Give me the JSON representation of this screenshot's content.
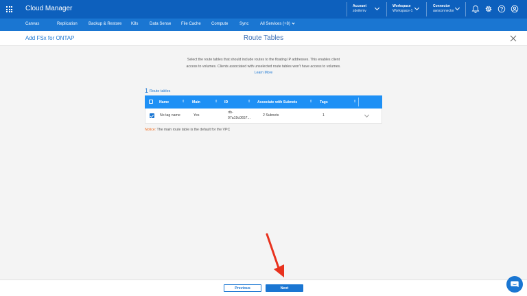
{
  "app": {
    "title": "Cloud Manager"
  },
  "topbar": {
    "account": {
      "label": "Account",
      "value": "zdeilemv"
    },
    "workspace": {
      "label": "Workspace",
      "value": "Workspace-1"
    },
    "connector": {
      "label": "Connector",
      "value": "awsconnector"
    },
    "icons": [
      "bell-icon",
      "gear-icon",
      "help-icon",
      "user-icon"
    ]
  },
  "nav": {
    "items": [
      "Canvas",
      "Replication",
      "Backup & Restore",
      "K8s",
      "Data Sense",
      "File Cache",
      "Compute",
      "Sync"
    ],
    "more": "All Services (+8)"
  },
  "header": {
    "back_title": "Add FSx for ONTAP",
    "page_title": "Route Tables"
  },
  "description": {
    "text": "Select the route tables that should include routes to the floating IP addresses. This enables client access to volumes. Clients associated with unselected route tables won't have access to volumes.",
    "link": "Learn More"
  },
  "route_tables": {
    "count": "1",
    "count_label": "Route tables",
    "columns": [
      "Name",
      "Main",
      "ID",
      "Associate with Subnets",
      "Tags"
    ],
    "rows": [
      {
        "name": "No tag name",
        "main": "Yes",
        "id_line1": "rtb-",
        "id_line2": "07a19c0657...",
        "subnets": "2 Subnets",
        "tags": "1"
      }
    ]
  },
  "notice": {
    "label": "Notice:",
    "text": "The main route table is the default for the VPC"
  },
  "footer": {
    "previous": "Previous",
    "next": "Next"
  },
  "colors": {
    "topbar": "#0d60bd",
    "nav": "#1a76d2",
    "table_header": "#1e90f5",
    "accent": "#1a76d2",
    "annotation_arrow": "#e8321e"
  }
}
